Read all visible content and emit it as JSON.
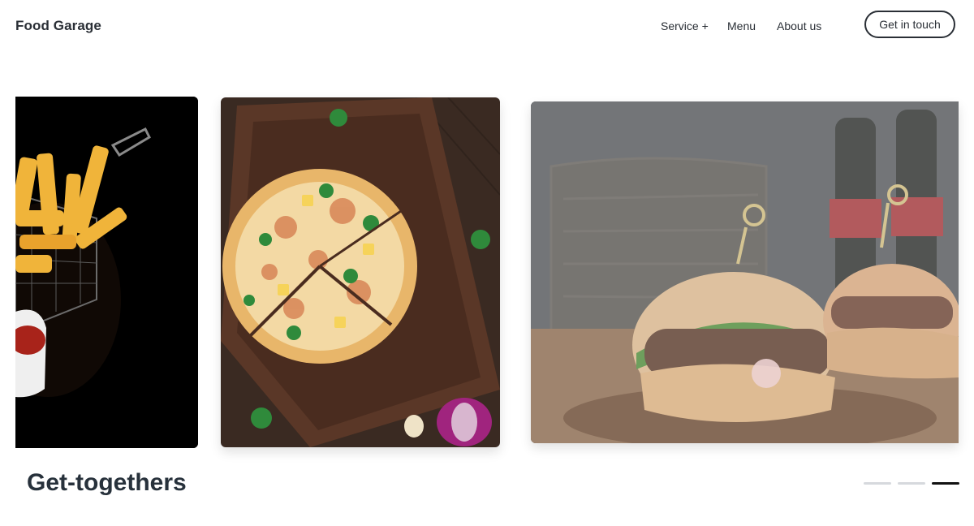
{
  "header": {
    "brand": "Food Garage",
    "nav": {
      "service": "Service +",
      "menu": "Menu",
      "about": "About us"
    },
    "cta": "Get in touch"
  },
  "carousel": {
    "slides": [
      {
        "subject": "french fries in a wire basket with ketchup"
      },
      {
        "subject": "sliced pizza on a wooden board"
      },
      {
        "subject": "burgers with cola bottles"
      }
    ],
    "caption": "Get-togethers",
    "indicator": {
      "count": 3,
      "active_index": 2
    }
  },
  "colors": {
    "text": "#27313b",
    "indicator_active": "#111111",
    "indicator_inactive": "#d6d9dd"
  },
  "icons": [
    "fries-image",
    "pizza-image",
    "burger-image"
  ]
}
